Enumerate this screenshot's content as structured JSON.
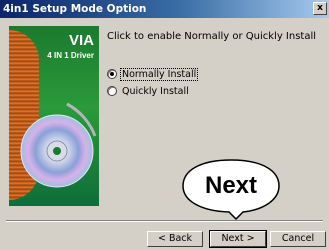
{
  "window": {
    "title": "4in1 Setup Mode Option",
    "close_label": "x"
  },
  "banner": {
    "brand": "VIA",
    "subtitle": "4 IN 1 Driver"
  },
  "main": {
    "instruction": "Click to enable Normally or Quickly Install",
    "options": [
      {
        "label": "Normally Install",
        "selected": true
      },
      {
        "label": "Quickly Install",
        "selected": false
      }
    ]
  },
  "buttons": {
    "back": "< Back",
    "next": "Next >",
    "cancel": "Cancel"
  },
  "callout": {
    "text": "Next"
  },
  "colors": {
    "titlebar_start": "#0a246a",
    "titlebar_end": "#a6caf0",
    "dialog_face": "#d4d0c8",
    "banner_green": "#1b7a2e"
  }
}
